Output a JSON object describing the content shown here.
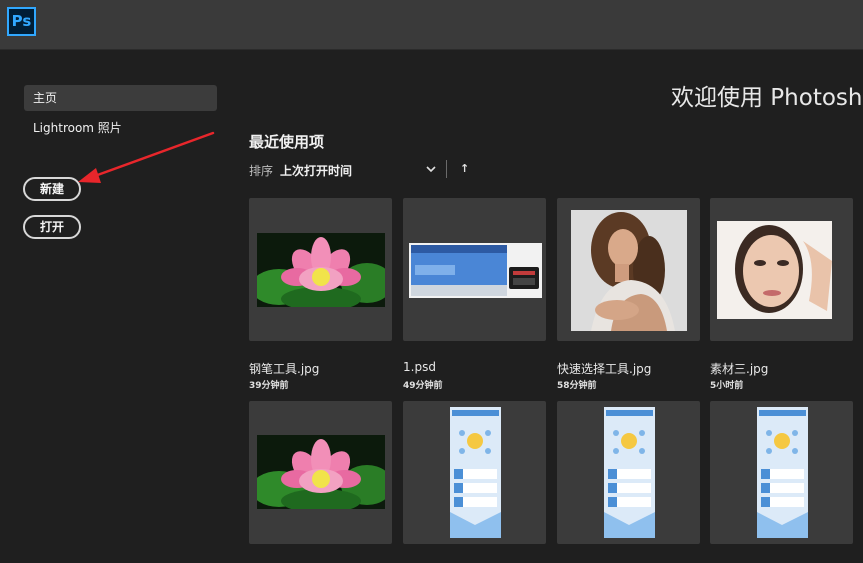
{
  "app": {
    "logo_text": "Ps"
  },
  "sidebar": {
    "items": [
      {
        "label": "主页",
        "active": true
      },
      {
        "label": "Lightroom 照片",
        "active": false
      }
    ],
    "new_button": "新建",
    "open_button": "打开"
  },
  "main": {
    "welcome": "欢迎使用 Photoshop",
    "recent_title": "最近使用项",
    "sort_label": "排序",
    "sort_value": "上次打开时间"
  },
  "recent_files": [
    {
      "name": "钢笔工具.jpg",
      "time": "39分钟前",
      "thumb": "lotus-photo"
    },
    {
      "name": "1.psd",
      "time": "49分钟前",
      "thumb": "screen-photo"
    },
    {
      "name": "快速选择工具.jpg",
      "time": "58分钟前",
      "thumb": "woman-portrait"
    },
    {
      "name": "素材三.jpg",
      "time": "5小时前",
      "thumb": "face-portrait"
    },
    {
      "name": "",
      "time": "",
      "thumb": "lotus-photo"
    },
    {
      "name": "",
      "time": "",
      "thumb": "infographic"
    },
    {
      "name": "",
      "time": "",
      "thumb": "infographic"
    },
    {
      "name": "",
      "time": "",
      "thumb": "infographic"
    }
  ],
  "colors": {
    "background": "#1f1f1f",
    "topbar": "#3a3a3a",
    "tile": "#3b3b3b",
    "ps_blue": "#31a8ff",
    "annotation_red": "#e8262b"
  }
}
